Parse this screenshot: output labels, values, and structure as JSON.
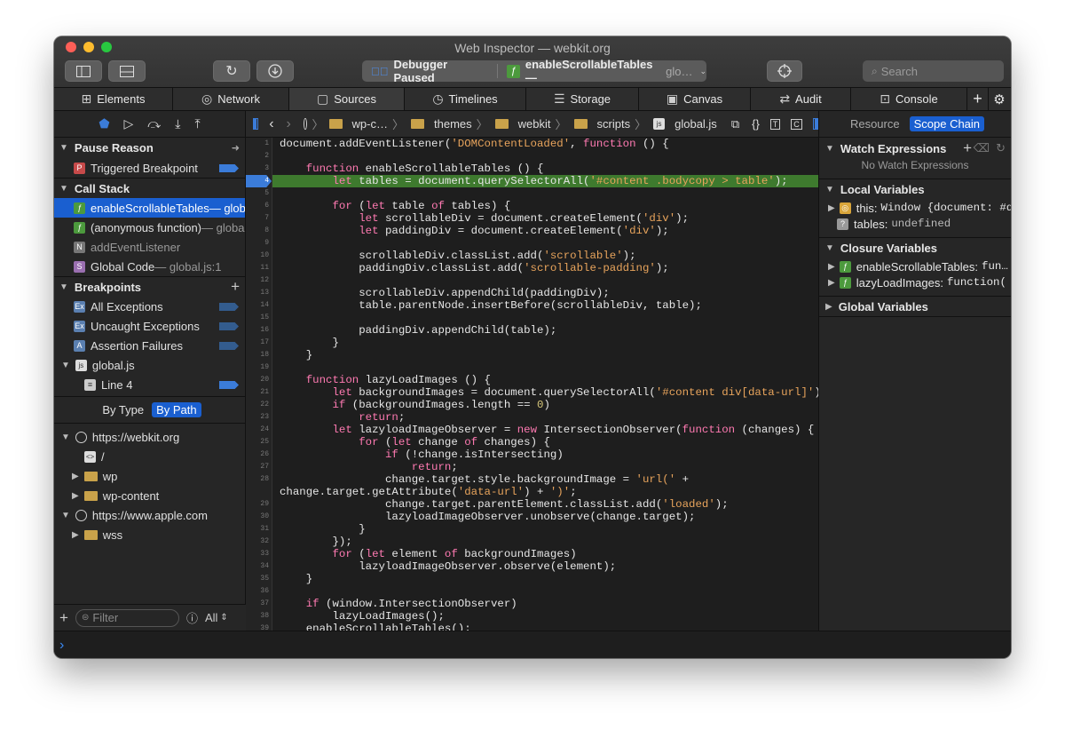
{
  "window": {
    "title": "Web Inspector — webkit.org"
  },
  "toolbar": {
    "status_label": "Debugger Paused",
    "frame_label": "enableScrollableTables —",
    "frame_suffix": "glo…",
    "search_placeholder": "Search"
  },
  "tabs": [
    "Elements",
    "Network",
    "Sources",
    "Timelines",
    "Storage",
    "Canvas",
    "Audit",
    "Console"
  ],
  "left": {
    "pause_reason": {
      "header": "Pause Reason",
      "item": "Triggered Breakpoint"
    },
    "call_stack": {
      "header": "Call Stack",
      "items": [
        {
          "label": "enableScrollableTables",
          "suffix": " — glob",
          "icon": "ƒ"
        },
        {
          "label": "(anonymous function)",
          "suffix": " — globa",
          "icon": "ƒ"
        },
        {
          "label": "addEventListener",
          "suffix": "",
          "icon": "N"
        },
        {
          "label": "Global Code",
          "suffix": " — global.js:1",
          "icon": "S"
        }
      ]
    },
    "breakpoints": {
      "header": "Breakpoints",
      "items": [
        "All Exceptions",
        "Uncaught Exceptions",
        "Assertion Failures"
      ],
      "file": "global.js",
      "line": "Line 4"
    },
    "group": {
      "by_type": "By Type",
      "by_path": "By Path"
    },
    "tree": {
      "origin1": "https://webkit.org",
      "root": "/",
      "wp": "wp",
      "wp_content": "wp-content",
      "origin2": "https://www.apple.com",
      "wss": "wss"
    },
    "filter": {
      "placeholder": "Filter",
      "scope": "All"
    }
  },
  "breadcrumbs": [
    "wp-c…",
    "themes",
    "webkit",
    "scripts",
    "global.js"
  ],
  "code": {
    "line_numbers": [
      "1",
      "2",
      "3",
      "4",
      "5",
      "6",
      "7",
      "8",
      "9",
      "10",
      "11",
      "12",
      "13",
      "14",
      "15",
      "16",
      "17",
      "18",
      "19",
      "20",
      "21",
      "22",
      "23",
      "24",
      "25",
      "26",
      "27",
      "28",
      "",
      "29",
      "30",
      "31",
      "32",
      "33",
      "34",
      "35",
      "36",
      "37",
      "38",
      "39"
    ],
    "lines": [
      "document.addEventListener('DOMContentLoaded', function () {",
      "",
      "    function enableScrollableTables () {",
      "        let tables = document.querySelectorAll('#content .bodycopy > table');",
      "",
      "        for (let table of tables) {",
      "            let scrollableDiv = document.createElement('div');",
      "            let paddingDiv = document.createElement('div');",
      "",
      "            scrollableDiv.classList.add('scrollable');",
      "            paddingDiv.classList.add('scrollable-padding');",
      "",
      "            scrollableDiv.appendChild(paddingDiv);",
      "            table.parentNode.insertBefore(scrollableDiv, table);",
      "",
      "            paddingDiv.appendChild(table);",
      "        }",
      "    }",
      "",
      "    function lazyLoadImages () {",
      "        let backgroundImages = document.querySelectorAll('#content div[data-url]');",
      "        if (backgroundImages.length == 0)",
      "            return;",
      "        let lazyloadImageObserver = new IntersectionObserver(function (changes) {",
      "            for (let change of changes) {",
      "                if (!change.isIntersecting)",
      "                    return;",
      "                change.target.style.backgroundImage = 'url(' +",
      "change.target.getAttribute('data-url') + ')';",
      "                change.target.parentElement.classList.add('loaded');",
      "                lazyloadImageObserver.unobserve(change.target);",
      "            }",
      "        });",
      "        for (let element of backgroundImages)",
      "            lazyloadImageObserver.observe(element);",
      "    }",
      "",
      "    if (window.IntersectionObserver)",
      "        lazyLoadImages();",
      "    enableScrollableTables();"
    ],
    "highlighted_line": "4"
  },
  "right": {
    "tabs": {
      "resource": "Resource",
      "scope": "Scope Chain"
    },
    "watch": {
      "header": "Watch Expressions",
      "empty": "No Watch Expressions"
    },
    "locals": {
      "header": "Local Variables",
      "this_label": "this:",
      "this_value": "Window {document: #d",
      "tables_label": "tables:",
      "tables_value": "undefined"
    },
    "closure": {
      "header": "Closure Variables",
      "item1": "enableScrollableTables:",
      "item1_value": "fun…",
      "item2": "lazyLoadImages:",
      "item2_value": "function("
    },
    "global": {
      "header": "Global Variables"
    }
  },
  "console": {
    "prompt": "›"
  },
  "colors": {
    "accent": "#1a5fd0",
    "highlight": "#3e7a2e",
    "keyword": "#ff7ab2",
    "string": "#e8a45c"
  }
}
